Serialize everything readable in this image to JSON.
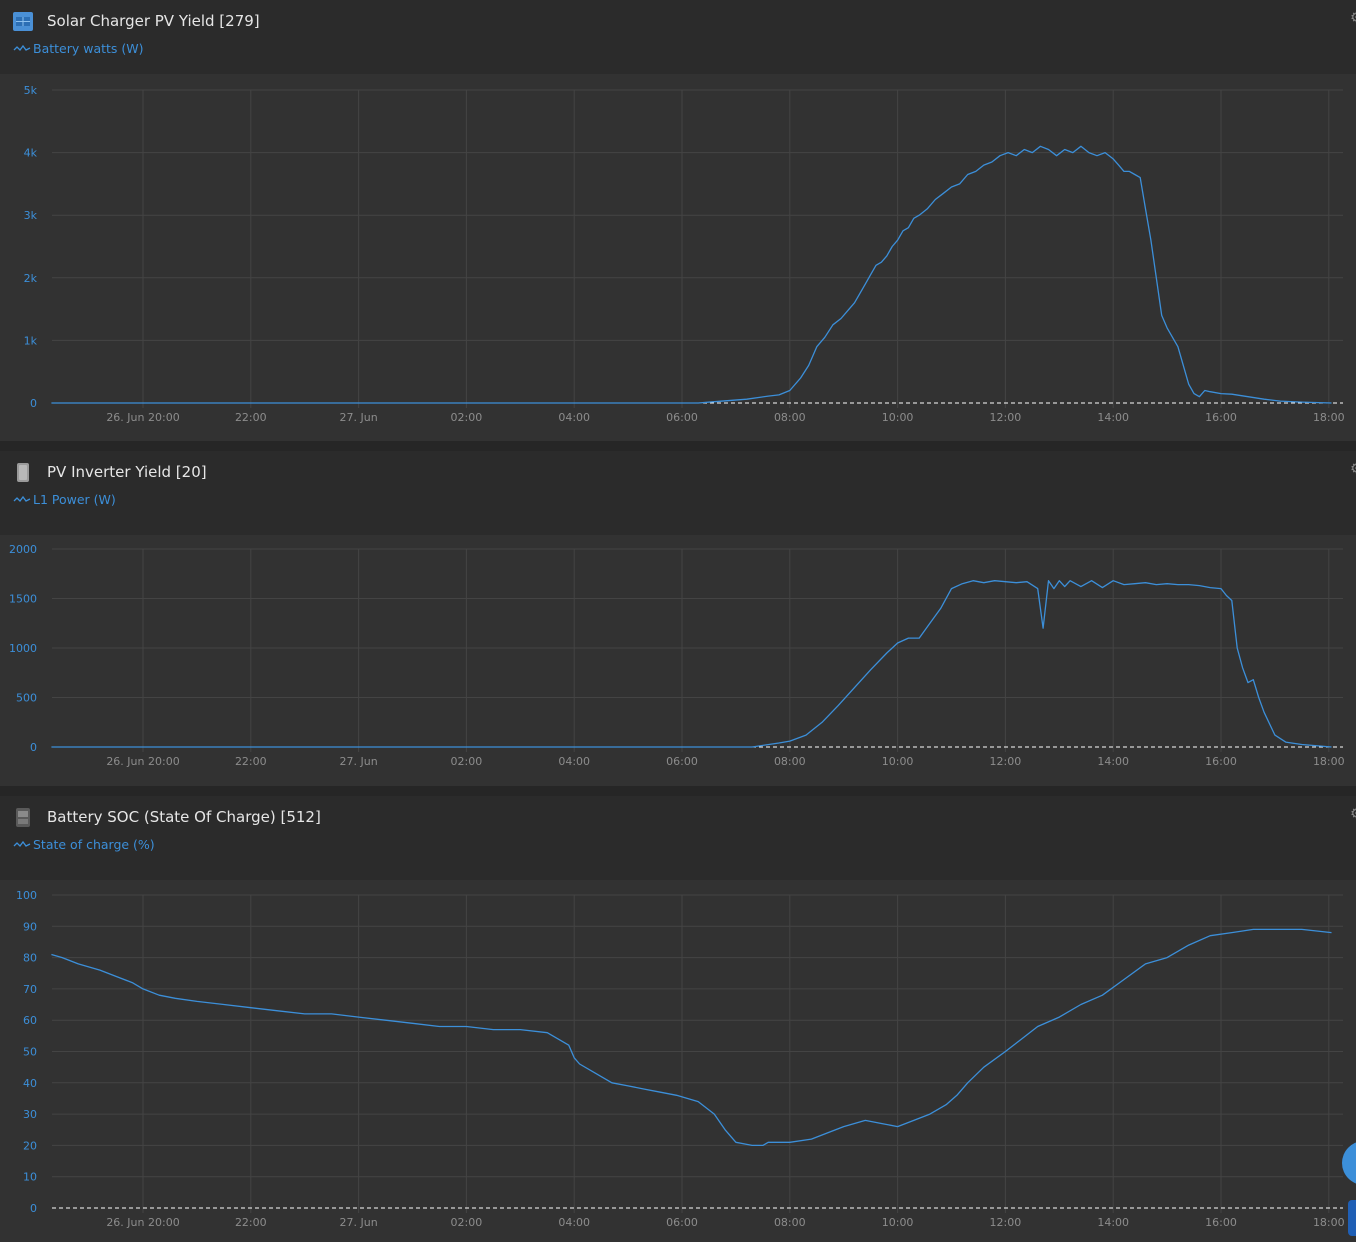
{
  "panels": [
    {
      "title": "Solar Charger PV Yield [279]",
      "device_icon": "solar-charger-icon",
      "series_label": "Battery watts (W)",
      "chart_data": {
        "type": "line",
        "title": "",
        "xlabel": "",
        "ylabel": "",
        "x_unit": "hours since 26. Jun 20:00",
        "x_range": [
          -1.7,
          22.05
        ],
        "x_ticks": [
          "26. Jun 20:00",
          "22:00",
          "27. Jun",
          "02:00",
          "04:00",
          "06:00",
          "08:00",
          "10:00",
          "12:00",
          "14:00",
          "16:00",
          "18:00"
        ],
        "ylim": [
          0,
          5000
        ],
        "y_ticks": [
          0,
          1000,
          2000,
          3000,
          4000,
          5000
        ],
        "y_tick_labels": [
          "0",
          "1k",
          "2k",
          "3k",
          "4k",
          "5k"
        ],
        "grid": true,
        "series": [
          {
            "color": "#3c8fd9",
            "x": [
              -1.7,
              10.3,
              10.6,
              11.2,
              11.6,
              11.8,
              12.0,
              12.2,
              12.35,
              12.5,
              12.65,
              12.8,
              12.95,
              13.1,
              13.2,
              13.3,
              13.4,
              13.5,
              13.6,
              13.7,
              13.8,
              13.9,
              14.0,
              14.1,
              14.2,
              14.3,
              14.4,
              14.55,
              14.7,
              14.85,
              15.0,
              15.15,
              15.3,
              15.45,
              15.6,
              15.75,
              15.9,
              16.05,
              16.2,
              16.35,
              16.5,
              16.65,
              16.8,
              16.95,
              17.1,
              17.25,
              17.4,
              17.55,
              17.7,
              17.85,
              18.0,
              18.1,
              18.2,
              18.3,
              18.4,
              18.5,
              18.6,
              18.7,
              18.8,
              18.9,
              19.0,
              19.2,
              19.4,
              19.5,
              19.6,
              19.7,
              19.8,
              20.0,
              20.2,
              20.5,
              20.8,
              21.1,
              21.5,
              22.05
            ],
            "y": [
              0,
              0,
              20,
              60,
              110,
              130,
              200,
              400,
              600,
              900,
              1050,
              1250,
              1350,
              1500,
              1600,
              1750,
              1900,
              2050,
              2200,
              2250,
              2350,
              2500,
              2600,
              2750,
              2800,
              2950,
              3000,
              3100,
              3250,
              3350,
              3450,
              3500,
              3650,
              3700,
              3800,
              3850,
              3950,
              4000,
              3950,
              4050,
              4000,
              4100,
              4050,
              3950,
              4050,
              4000,
              4100,
              4000,
              3950,
              4000,
              3900,
              3800,
              3700,
              3700,
              3650,
              3600,
              3100,
              2600,
              2000,
              1400,
              1200,
              900,
              300,
              150,
              100,
              200,
              180,
              150,
              140,
              100,
              60,
              30,
              15,
              0
            ]
          }
        ]
      }
    },
    {
      "title": "PV Inverter Yield [20]",
      "device_icon": "pv-inverter-icon",
      "series_label": "L1 Power (W)",
      "chart_data": {
        "type": "line",
        "title": "",
        "xlabel": "",
        "ylabel": "",
        "x_unit": "hours since 26. Jun 20:00",
        "x_range": [
          -1.7,
          22.05
        ],
        "x_ticks": [
          "26. Jun 20:00",
          "22:00",
          "27. Jun",
          "02:00",
          "04:00",
          "06:00",
          "08:00",
          "10:00",
          "12:00",
          "14:00",
          "16:00",
          "18:00"
        ],
        "ylim": [
          0,
          2000
        ],
        "y_ticks": [
          0,
          500,
          1000,
          1500,
          2000
        ],
        "y_tick_labels": [
          "0",
          "500",
          "1000",
          "1500",
          "2000"
        ],
        "grid": true,
        "series": [
          {
            "color": "#3c8fd9",
            "x": [
              -1.7,
              11.3,
              11.8,
              12.0,
              12.3,
              12.6,
              12.9,
              13.2,
              13.5,
              13.8,
              14.0,
              14.2,
              14.4,
              14.6,
              14.8,
              15.0,
              15.2,
              15.4,
              15.6,
              15.8,
              16.0,
              16.2,
              16.4,
              16.6,
              16.7,
              16.8,
              16.9,
              17.0,
              17.1,
              17.2,
              17.4,
              17.6,
              17.8,
              18.0,
              18.2,
              18.4,
              18.6,
              18.8,
              19.0,
              19.2,
              19.4,
              19.6,
              19.8,
              20.0,
              20.1,
              20.2,
              20.3,
              20.4,
              20.5,
              20.6,
              20.7,
              20.8,
              21.0,
              21.2,
              21.5,
              22.05
            ],
            "y": [
              0,
              0,
              40,
              60,
              120,
              250,
              420,
              600,
              780,
              950,
              1050,
              1100,
              1100,
              1250,
              1400,
              1600,
              1650,
              1680,
              1660,
              1680,
              1670,
              1660,
              1670,
              1600,
              1200,
              1680,
              1600,
              1680,
              1620,
              1680,
              1620,
              1680,
              1610,
              1680,
              1640,
              1650,
              1660,
              1640,
              1650,
              1640,
              1640,
              1630,
              1610,
              1600,
              1530,
              1480,
              1000,
              800,
              650,
              680,
              500,
              350,
              120,
              50,
              25,
              0
            ]
          }
        ]
      }
    },
    {
      "title": "Battery SOC (State Of Charge) [512]",
      "device_icon": "battery-monitor-icon",
      "series_label": "State of charge (%)",
      "chart_data": {
        "type": "line",
        "title": "",
        "xlabel": "",
        "ylabel": "",
        "x_unit": "hours since 26. Jun 20:00",
        "x_range": [
          -1.7,
          22.05
        ],
        "x_ticks": [
          "26. Jun 20:00",
          "22:00",
          "27. Jun",
          "02:00",
          "04:00",
          "06:00",
          "08:00",
          "10:00",
          "12:00",
          "14:00",
          "16:00",
          "18:00"
        ],
        "ylim": [
          0,
          100
        ],
        "y_ticks": [
          0,
          10,
          20,
          30,
          40,
          50,
          60,
          70,
          80,
          90,
          100
        ],
        "y_tick_labels": [
          "0",
          "10",
          "20",
          "30",
          "40",
          "50",
          "60",
          "70",
          "80",
          "90",
          "100"
        ],
        "grid": true,
        "series": [
          {
            "color": "#3c8fd9",
            "x": [
              -1.7,
              -1.5,
              -1.2,
              -1.0,
              -0.8,
              -0.5,
              -0.2,
              0.0,
              0.3,
              0.6,
              1.0,
              1.5,
              2.0,
              2.5,
              3.0,
              3.5,
              4.0,
              4.5,
              5.0,
              5.5,
              6.0,
              6.5,
              7.0,
              7.5,
              7.9,
              8.0,
              8.1,
              8.4,
              8.7,
              9.0,
              9.3,
              9.6,
              9.9,
              10.3,
              10.6,
              10.8,
              11.0,
              11.3,
              11.5,
              11.6,
              11.7,
              12.0,
              12.4,
              12.7,
              13.0,
              13.4,
              13.7,
              14.0,
              14.3,
              14.6,
              14.9,
              15.1,
              15.3,
              15.6,
              16.0,
              16.3,
              16.6,
              17.0,
              17.4,
              17.8,
              18.2,
              18.6,
              19.0,
              19.4,
              19.8,
              20.2,
              20.6,
              21.0,
              21.5,
              22.05
            ],
            "y": [
              81,
              80,
              78,
              77,
              76,
              74,
              72,
              70,
              68,
              67,
              66,
              65,
              64,
              63,
              62,
              62,
              61,
              60,
              59,
              58,
              58,
              57,
              57,
              56,
              52,
              48,
              46,
              43,
              40,
              39,
              38,
              37,
              36,
              34,
              30,
              25,
              21,
              20,
              20,
              21,
              21,
              21,
              22,
              24,
              26,
              28,
              27,
              26,
              28,
              30,
              33,
              36,
              40,
              45,
              50,
              54,
              58,
              61,
              65,
              68,
              73,
              78,
              80,
              84,
              87,
              88,
              89,
              89,
              89,
              88,
              86,
              85
            ]
          }
        ]
      }
    }
  ],
  "colors": {
    "page_bg": "#262626",
    "panel_bg": "#2b2b2b",
    "chart_bg": "#323232",
    "grid": "#444444",
    "axis_label": "#3c8fd9",
    "x_tick_label": "#8c8c8c",
    "series": "#3c8fd9",
    "title": "#e6e6e6"
  }
}
